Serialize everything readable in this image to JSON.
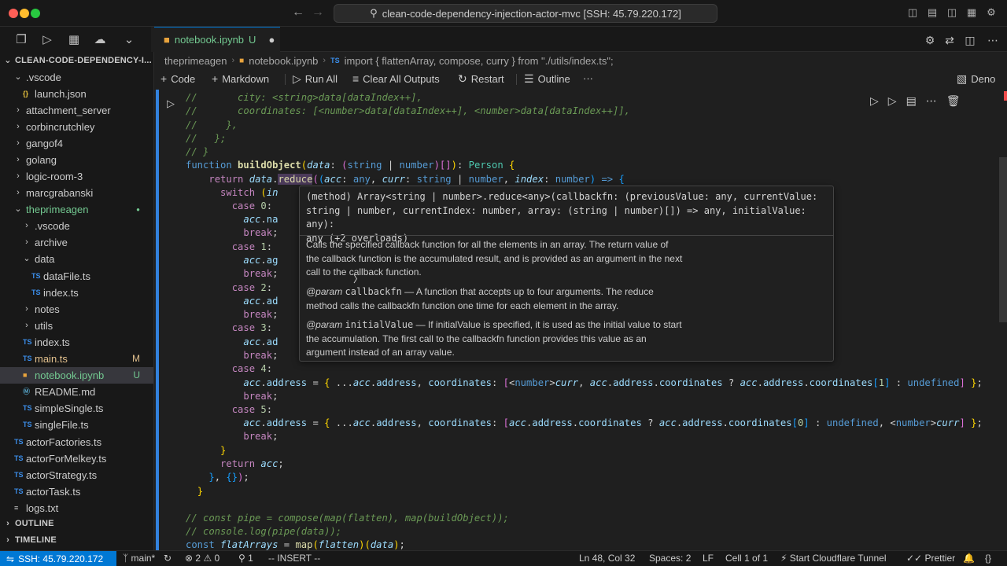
{
  "window": {
    "title": "clean-code-dependency-injection-actor-mvc [SSH: 45.79.220.172]"
  },
  "explorer": {
    "root": "CLEAN-CODE-DEPENDENCY-I...",
    "items": [
      {
        "label": ".vscode",
        "type": "folder",
        "open": true
      },
      {
        "label": "launch.json",
        "type": "json"
      },
      {
        "label": "attachment_server",
        "type": "folder"
      },
      {
        "label": "corbincrutchley",
        "type": "folder"
      },
      {
        "label": "gangof4",
        "type": "folder"
      },
      {
        "label": "golang",
        "type": "folder"
      },
      {
        "label": "logic-room-3",
        "type": "folder"
      },
      {
        "label": "marcgrabanski",
        "type": "folder"
      },
      {
        "label": "theprimeagen",
        "type": "folder",
        "open": true
      },
      {
        "label": ".vscode",
        "type": "folder"
      },
      {
        "label": "archive",
        "type": "folder"
      },
      {
        "label": "data",
        "type": "folder",
        "open": true
      },
      {
        "label": "dataFile.ts",
        "type": "ts"
      },
      {
        "label": "index.ts",
        "type": "ts"
      },
      {
        "label": "notes",
        "type": "folder"
      },
      {
        "label": "utils",
        "type": "folder"
      },
      {
        "label": "index.ts",
        "type": "ts"
      },
      {
        "label": "main.ts",
        "type": "ts",
        "badge": "M"
      },
      {
        "label": "notebook.ipynb",
        "type": "nb",
        "badge": "U"
      },
      {
        "label": "README.md",
        "type": "md"
      },
      {
        "label": "simpleSingle.ts",
        "type": "ts"
      },
      {
        "label": "singleFile.ts",
        "type": "ts"
      },
      {
        "label": "actorFactories.ts",
        "type": "ts"
      },
      {
        "label": "actorForMelkey.ts",
        "type": "ts"
      },
      {
        "label": "actorStrategy.ts",
        "type": "ts"
      },
      {
        "label": "actorTask.ts",
        "type": "ts"
      },
      {
        "label": "logs.txt",
        "type": "txt"
      }
    ],
    "outline": "OUTLINE",
    "timeline": "TIMELINE"
  },
  "tab": {
    "label": "notebook.ipynb",
    "status": "U"
  },
  "breadcrumb": {
    "folder": "theprimeagen",
    "file": "notebook.ipynb",
    "lang": "TS",
    "symbol": "import { flattenArray, compose, curry } from \"./utils/index.ts\";"
  },
  "toolbar": {
    "code": "Code",
    "markdown": "Markdown",
    "run_all": "Run All",
    "clear_outputs": "Clear All Outputs",
    "restart": "Restart",
    "outline": "Outline",
    "more": "···",
    "kernel": "Deno"
  },
  "hover": {
    "sig1": "(method) Array<string | number>.reduce<any>(callbackfn: (previousValue: any, currentValue:",
    "sig2": "string | number, currentIndex: number, array: (string | number)[]) => any, initialValue: any):",
    "sig3": "any (+2 overloads)",
    "description": "Calls the specified callback function for all the elements in an array. The return value of the callback function is the accumulated result, and is provided as an argument in the next call to the callback function.",
    "param1_tag": "@param",
    "param1_name": "callbackfn",
    "param1_text": "— A function that accepts up to four arguments. The reduce method calls the callbackfn function one time for each element in the array.",
    "param2_tag": "@param",
    "param2_name": "initialValue",
    "param2_text": "— If initialValue is specified, it is used as the initial value to start the accumulation. The first call to the callbackfn function provides this value as an argument instead of an array value."
  },
  "status": {
    "remote": "SSH: 45.79.220.172",
    "branch": "main*",
    "errors": "2",
    "warnings": "0",
    "ports": "1",
    "mode": "-- INSERT --",
    "position": "Ln 48, Col 32",
    "spaces": "Spaces: 2",
    "eol": "LF",
    "cell": "Cell 1 of 1",
    "tunnel": "Start Cloudflare Tunnel",
    "prettier": "Prettier"
  }
}
